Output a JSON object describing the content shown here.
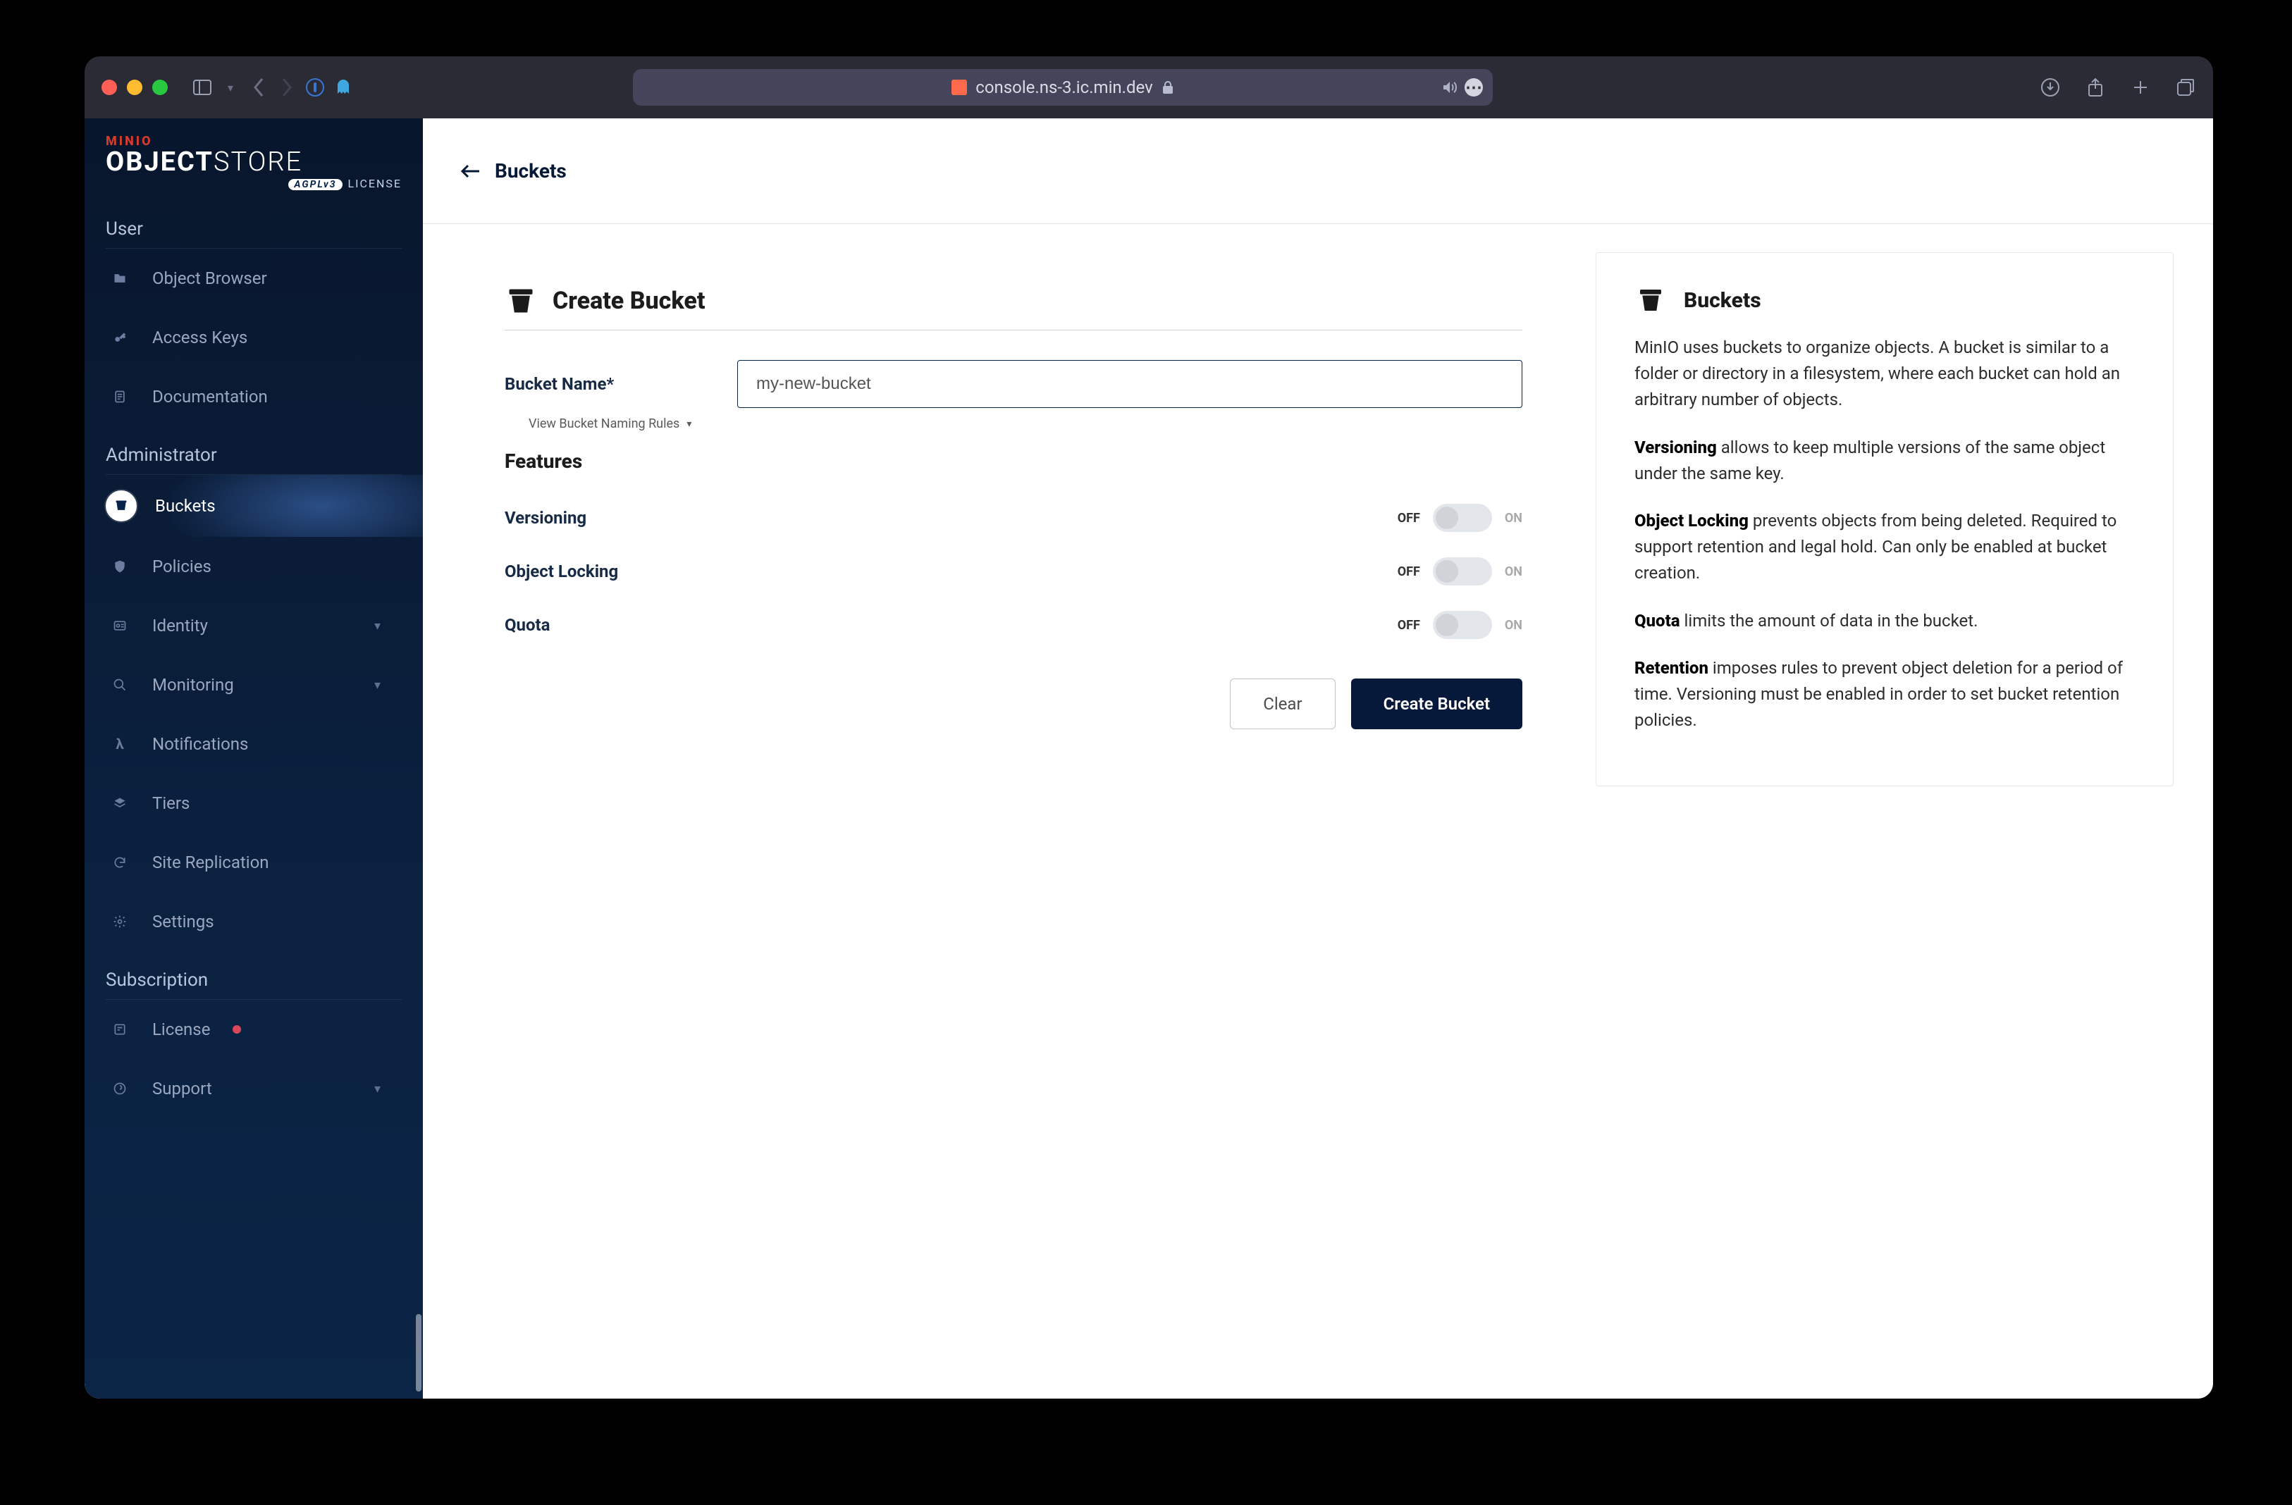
{
  "browser": {
    "url": "console.ns-3.ic.min.dev"
  },
  "logo": {
    "brand": "MINIO",
    "product1": "OBJECT",
    "product2": "STORE",
    "license_badge": "AGPLv3",
    "license_word": "LICENSE"
  },
  "sidebar": {
    "sections": [
      {
        "label": "User",
        "items": [
          {
            "icon": "folder-icon",
            "label": "Object Browser"
          },
          {
            "icon": "key-icon",
            "label": "Access Keys"
          },
          {
            "icon": "doc-icon",
            "label": "Documentation"
          }
        ]
      },
      {
        "label": "Administrator",
        "items": [
          {
            "icon": "bucket-icon",
            "label": "Buckets",
            "active": true
          },
          {
            "icon": "shield-icon",
            "label": "Policies"
          },
          {
            "icon": "id-icon",
            "label": "Identity",
            "expandable": true
          },
          {
            "icon": "search-icon",
            "label": "Monitoring",
            "expandable": true
          },
          {
            "icon": "lambda-icon",
            "label": "Notifications"
          },
          {
            "icon": "layers-icon",
            "label": "Tiers"
          },
          {
            "icon": "sync-icon",
            "label": "Site Replication"
          },
          {
            "icon": "gear-icon",
            "label": "Settings"
          }
        ]
      },
      {
        "label": "Subscription",
        "items": [
          {
            "icon": "license-icon",
            "label": "License",
            "dot": true
          },
          {
            "icon": "support-icon",
            "label": "Support",
            "expandable": true
          }
        ]
      }
    ]
  },
  "topbar": {
    "back_label": "Buckets"
  },
  "form": {
    "title": "Create Bucket",
    "bucket_name_label": "Bucket Name*",
    "bucket_name_value": "my-new-bucket",
    "naming_rules_label": "View Bucket Naming Rules",
    "features_heading": "Features",
    "features": [
      {
        "label": "Versioning",
        "state_off": "OFF",
        "state_on": "ON"
      },
      {
        "label": "Object Locking",
        "state_off": "OFF",
        "state_on": "ON"
      },
      {
        "label": "Quota",
        "state_off": "OFF",
        "state_on": "ON"
      }
    ],
    "clear_label": "Clear",
    "create_label": "Create Bucket"
  },
  "info": {
    "heading": "Buckets",
    "p1": "MinIO uses buckets to organize objects. A bucket is similar to a folder or directory in a filesystem, where each bucket can hold an arbitrary number of objects.",
    "p2a": "Versioning",
    "p2b": " allows to keep multiple versions of the same object under the same key.",
    "p3a": "Object Locking",
    "p3b": " prevents objects from being deleted. Required to support retention and legal hold. Can only be enabled at bucket creation.",
    "p4a": "Quota",
    "p4b": " limits the amount of data in the bucket.",
    "p5a": "Retention",
    "p5b": " imposes rules to prevent object deletion for a period of time. Versioning must be enabled in order to set bucket retention policies."
  }
}
